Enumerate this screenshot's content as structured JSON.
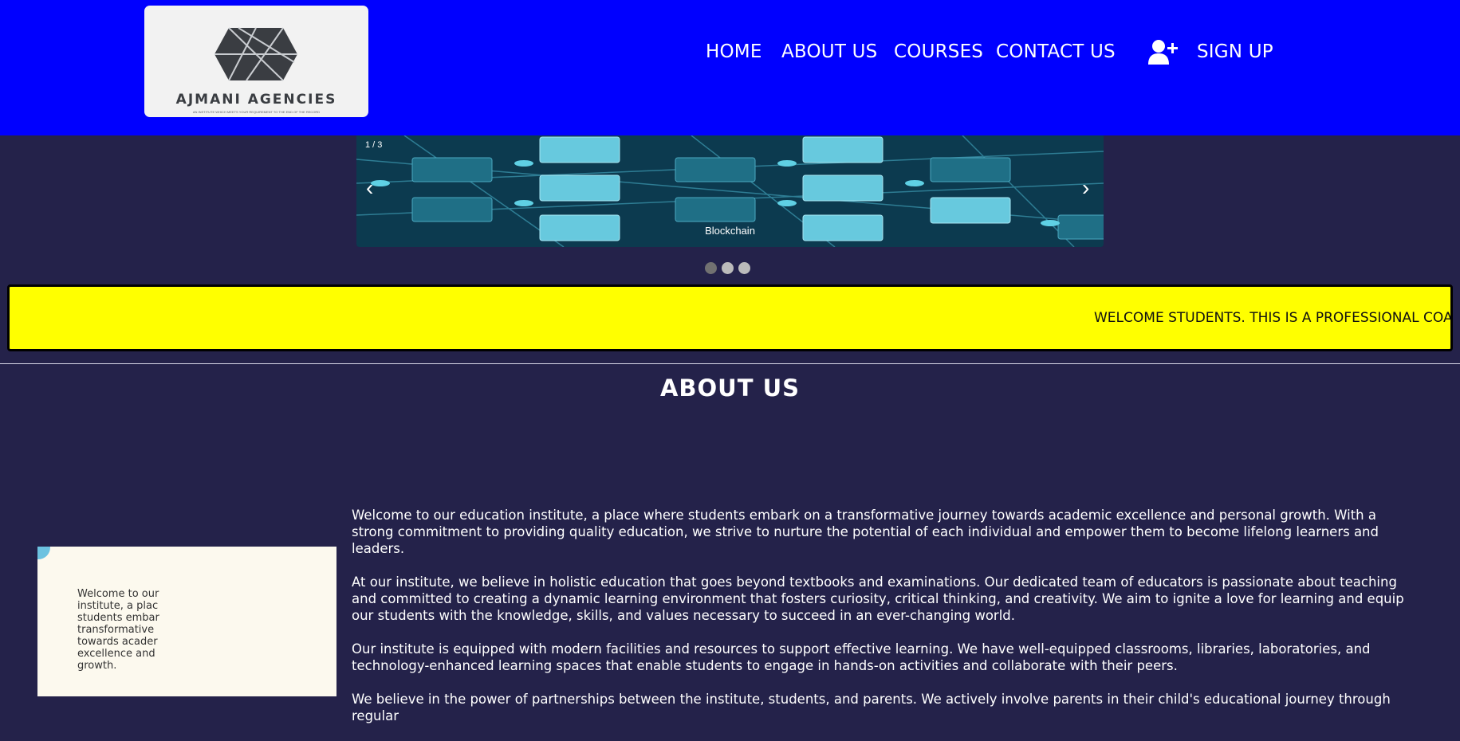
{
  "header": {
    "logo": {
      "name": "AJMANI AGENCIES",
      "tagline": "AN INSTITUTE WHICH MEETS YOUR REQUIREMENT TO THE END OF THE RECORD"
    },
    "nav": {
      "home": "HOME",
      "about": "ABOUT US",
      "courses": "COURSES",
      "contact": "CONTACT US",
      "signup": "SIGN UP"
    },
    "icons": {
      "signup": "user-plus-icon"
    },
    "background_color": "#0000ff"
  },
  "slider": {
    "counter": "1 / 3",
    "caption": "Blockchain",
    "prev_arrow": "‹",
    "next_arrow": "›",
    "slide_count": 3,
    "active_slide": 1
  },
  "marquee": {
    "text": "WELCOME STUDENTS. THIS IS A PROFESSIONAL COAC",
    "background_color": "#ffff00"
  },
  "about": {
    "title": "ABOUT US",
    "image_text": "Welcome to our\ninstitute, a plac\nstudents embar\ntransformative\ntowards acader\nexcellence and\ngrowth.",
    "paragraphs": [
      "Welcome to our education institute, a place where students embark on a transformative journey towards academic excellence and personal growth. With a strong commitment to providing quality education, we strive to nurture the potential of each individual and empower them to become lifelong learners and leaders.",
      "At our institute, we believe in holistic education that goes beyond textbooks and examinations. Our dedicated team of educators is passionate about teaching and committed to creating a dynamic learning environment that fosters curiosity, critical thinking, and creativity. We aim to ignite a love for learning and equip our students with the knowledge, skills, and values necessary to succeed in an ever-changing world.",
      "Our institute is equipped with modern facilities and resources to support effective learning. We have well-equipped classrooms, libraries, laboratories, and technology-enhanced learning spaces that enable students to engage in hands-on activities and collaborate with their peers.",
      "We believe in the power of partnerships between the institute, students, and parents. We actively involve parents in their child's educational journey through regular"
    ]
  },
  "colors": {
    "page_background": "#24224a",
    "text": "#ffffff"
  }
}
